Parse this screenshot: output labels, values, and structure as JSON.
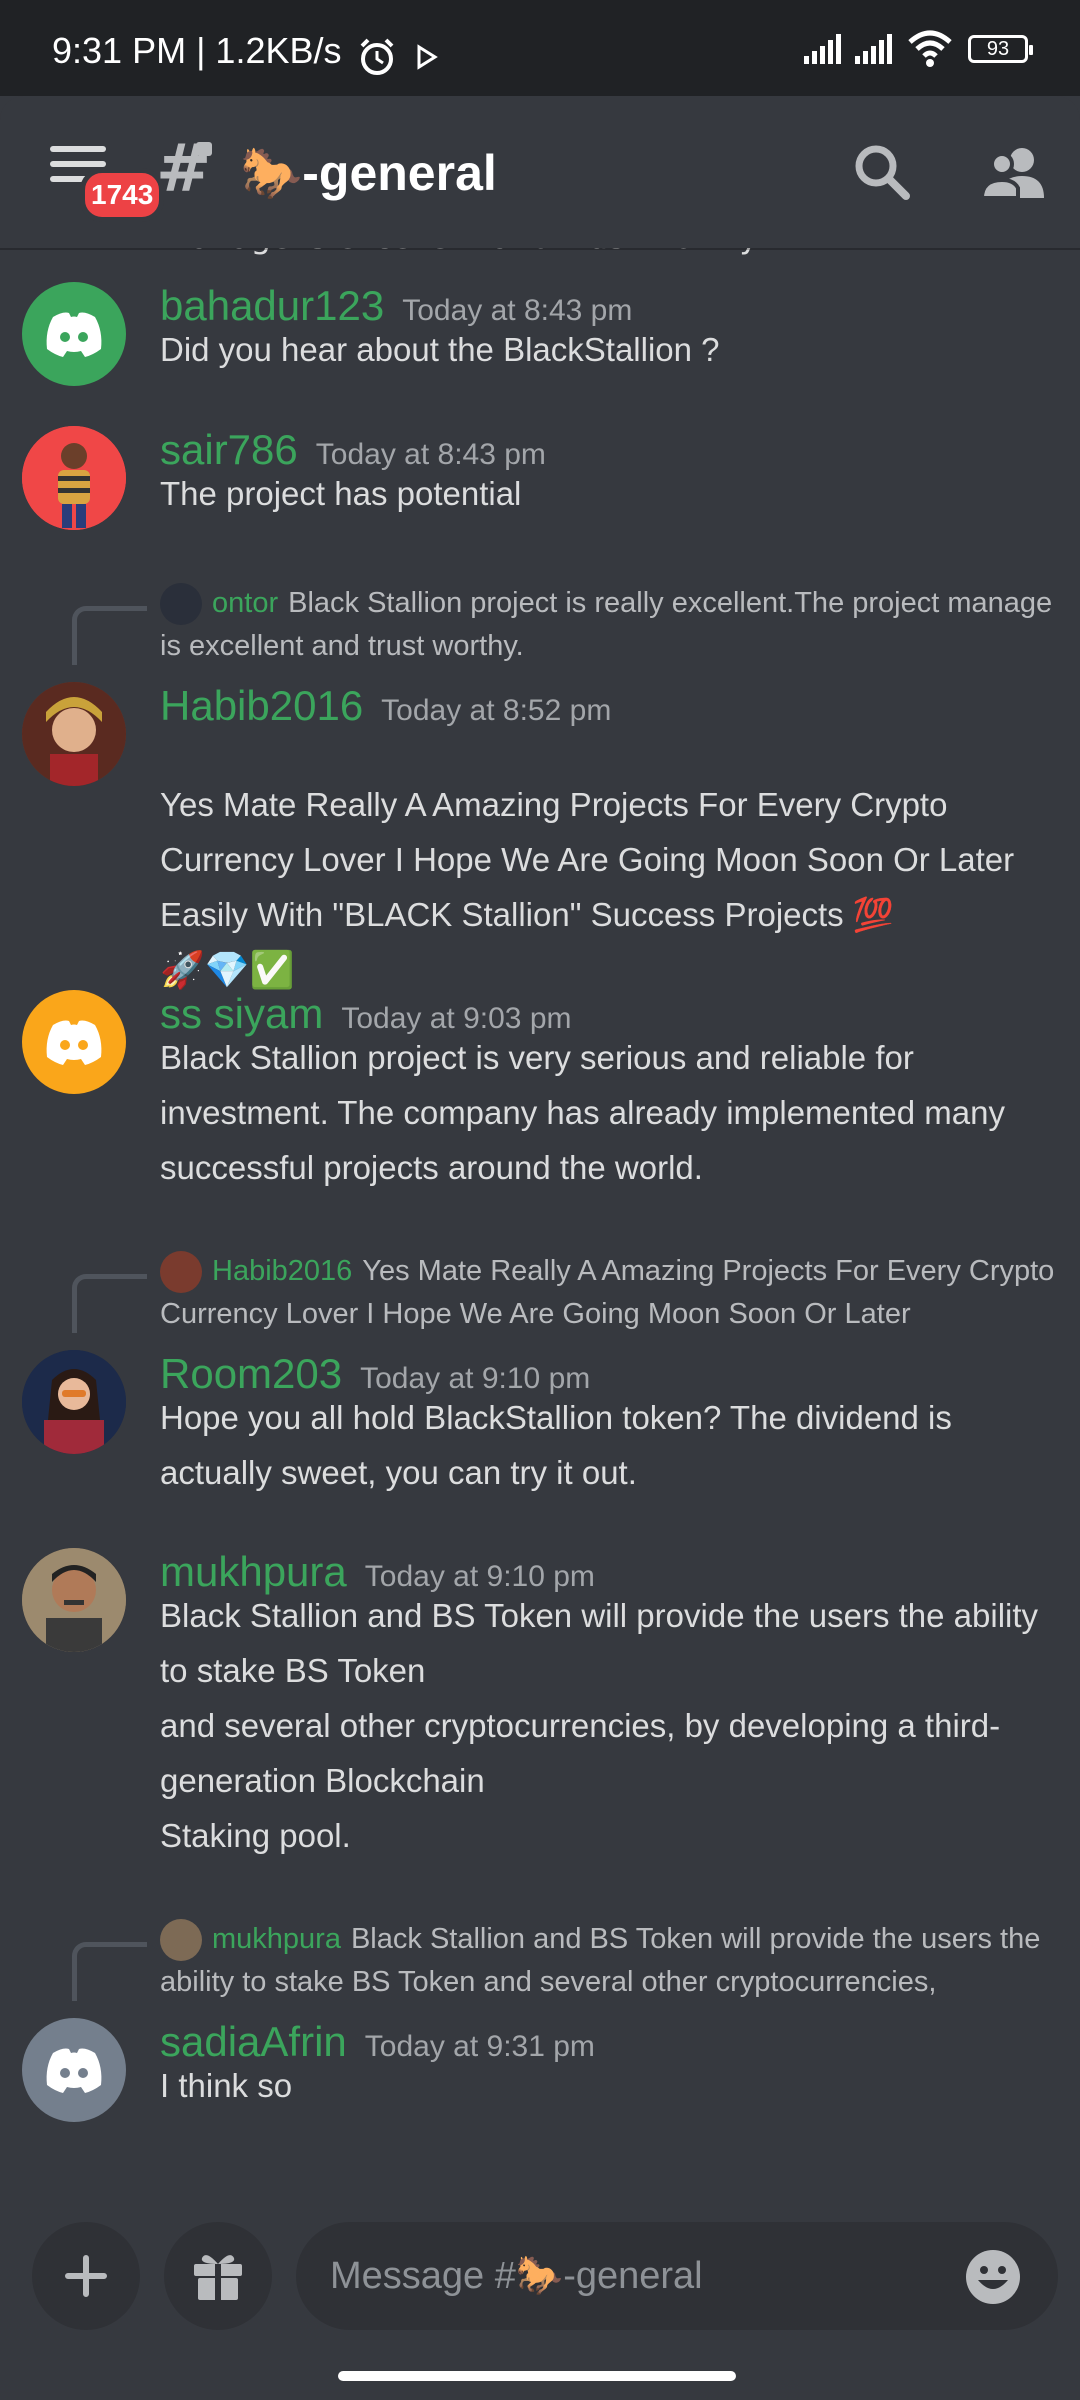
{
  "status_bar": {
    "time": "9:31 PM | 1.2KB/s",
    "battery": "93"
  },
  "header": {
    "notification_count": "1743",
    "channel_name": "🐎-general"
  },
  "top_partial_text": "manage is excellent and trust worthy.",
  "messages": [
    {
      "author": "bahadur123",
      "timestamp": "Today at 8:43 pm",
      "text": "Did you hear about the BlackStallion ?",
      "avatar": "discord-default-green",
      "avatar_color": "#3ba55c"
    },
    {
      "author": "sair786",
      "timestamp": "Today at 8:43 pm",
      "text": "The project has potential",
      "avatar": "photo-person",
      "avatar_color": "#f04747"
    },
    {
      "reply": {
        "author": "ontor",
        "text": "Black Stallion project is really excellent.The project manage is excellent and trust worthy."
      },
      "author": "Habib2016",
      "timestamp": "Today at 8:52 pm",
      "text": "Yes Mate Really A Amazing Projects For Every Crypto Currency Lover I Hope We Are Going Moon Soon Or Later Easily With \"BLACK Stallion\" Success Projects 💯",
      "emojis": "🚀💎✅",
      "avatar": "photo-person",
      "avatar_color": "#7a3b2e"
    },
    {
      "author": "ss siyam",
      "timestamp": "Today at 9:03 pm",
      "text": "Black Stallion project is very serious and reliable for investment. The company has already implemented many successful projects around the world.",
      "avatar": "discord-default-orange",
      "avatar_color": "#faa61a"
    },
    {
      "reply": {
        "author": "Habib2016",
        "text": "Yes Mate Really A Amazing Projects For Every Crypto Currency Lover I Hope We Are Going Moon Soon Or Later"
      },
      "author": "Room203",
      "timestamp": "Today at 9:10 pm",
      "text": "Hope you all hold BlackStallion token? The dividend is actually sweet, you can try it out.",
      "avatar": "photo-person",
      "avatar_color": "#1c2a4a"
    },
    {
      "author": "mukhpura",
      "timestamp": "Today at 9:10 pm",
      "text": "Black Stallion and BS Token will provide the users the ability to stake BS Token\nand several other cryptocurrencies, by developing a third-generation Blockchain\nStaking pool.",
      "avatar": "photo-person",
      "avatar_color": "#7d6a55"
    },
    {
      "reply": {
        "author": "mukhpura",
        "text": "Black Stallion and BS Token will provide the users the ability to stake BS Token  and several other cryptocurrencies,"
      },
      "author": "sadiaAfrin",
      "timestamp": "Today at 9:31 pm",
      "text": "I think so",
      "avatar": "discord-default-grey",
      "avatar_color": "#747f8d"
    }
  ],
  "composer": {
    "placeholder": "Message #🐎-general"
  },
  "colors": {
    "background": "#36393f",
    "header": "#36393f",
    "username": "#3ba55c",
    "badge": "#ed4245"
  }
}
